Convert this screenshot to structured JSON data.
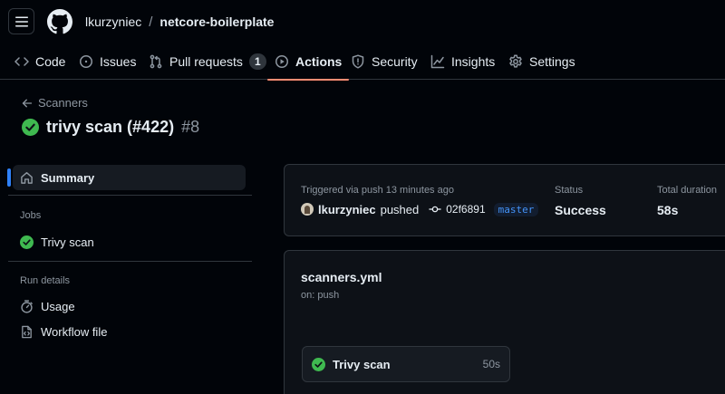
{
  "header": {
    "owner": "lkurzyniec",
    "separator": "/",
    "repo": "netcore-boilerplate"
  },
  "tabs": [
    {
      "label": "Code",
      "icon": "code-icon"
    },
    {
      "label": "Issues",
      "icon": "issue-icon"
    },
    {
      "label": "Pull requests",
      "icon": "pull-request-icon",
      "count": "1"
    },
    {
      "label": "Actions",
      "icon": "play-icon",
      "active": true
    },
    {
      "label": "Security",
      "icon": "shield-icon"
    },
    {
      "label": "Insights",
      "icon": "graph-icon"
    },
    {
      "label": "Settings",
      "icon": "gear-icon"
    }
  ],
  "run": {
    "back_label": "Scanners",
    "title": "trivy scan (#422)",
    "number": "#8"
  },
  "sidebar": {
    "summary_label": "Summary",
    "jobs_heading": "Jobs",
    "jobs": [
      {
        "label": "Trivy scan"
      }
    ],
    "run_details_heading": "Run details",
    "details": [
      {
        "label": "Usage",
        "icon": "stopwatch-icon"
      },
      {
        "label": "Workflow file",
        "icon": "file-code-icon"
      }
    ]
  },
  "summary": {
    "trigger_text": "Triggered via push 13 minutes ago",
    "actor": "lkurzyniec",
    "action": "pushed",
    "commit": "02f6891",
    "branch": "master",
    "status_label": "Status",
    "status_value": "Success",
    "duration_label": "Total duration",
    "duration_value": "58s"
  },
  "workflow": {
    "file": "scanners.yml",
    "trigger": "on: push",
    "job_name": "Trivy scan",
    "job_time": "50s"
  },
  "colors": {
    "background": "#010409",
    "card": "#0d1117",
    "border": "#30363d",
    "success": "#3fb950",
    "accent_tab": "#fd8c73",
    "link": "#4493f8"
  }
}
